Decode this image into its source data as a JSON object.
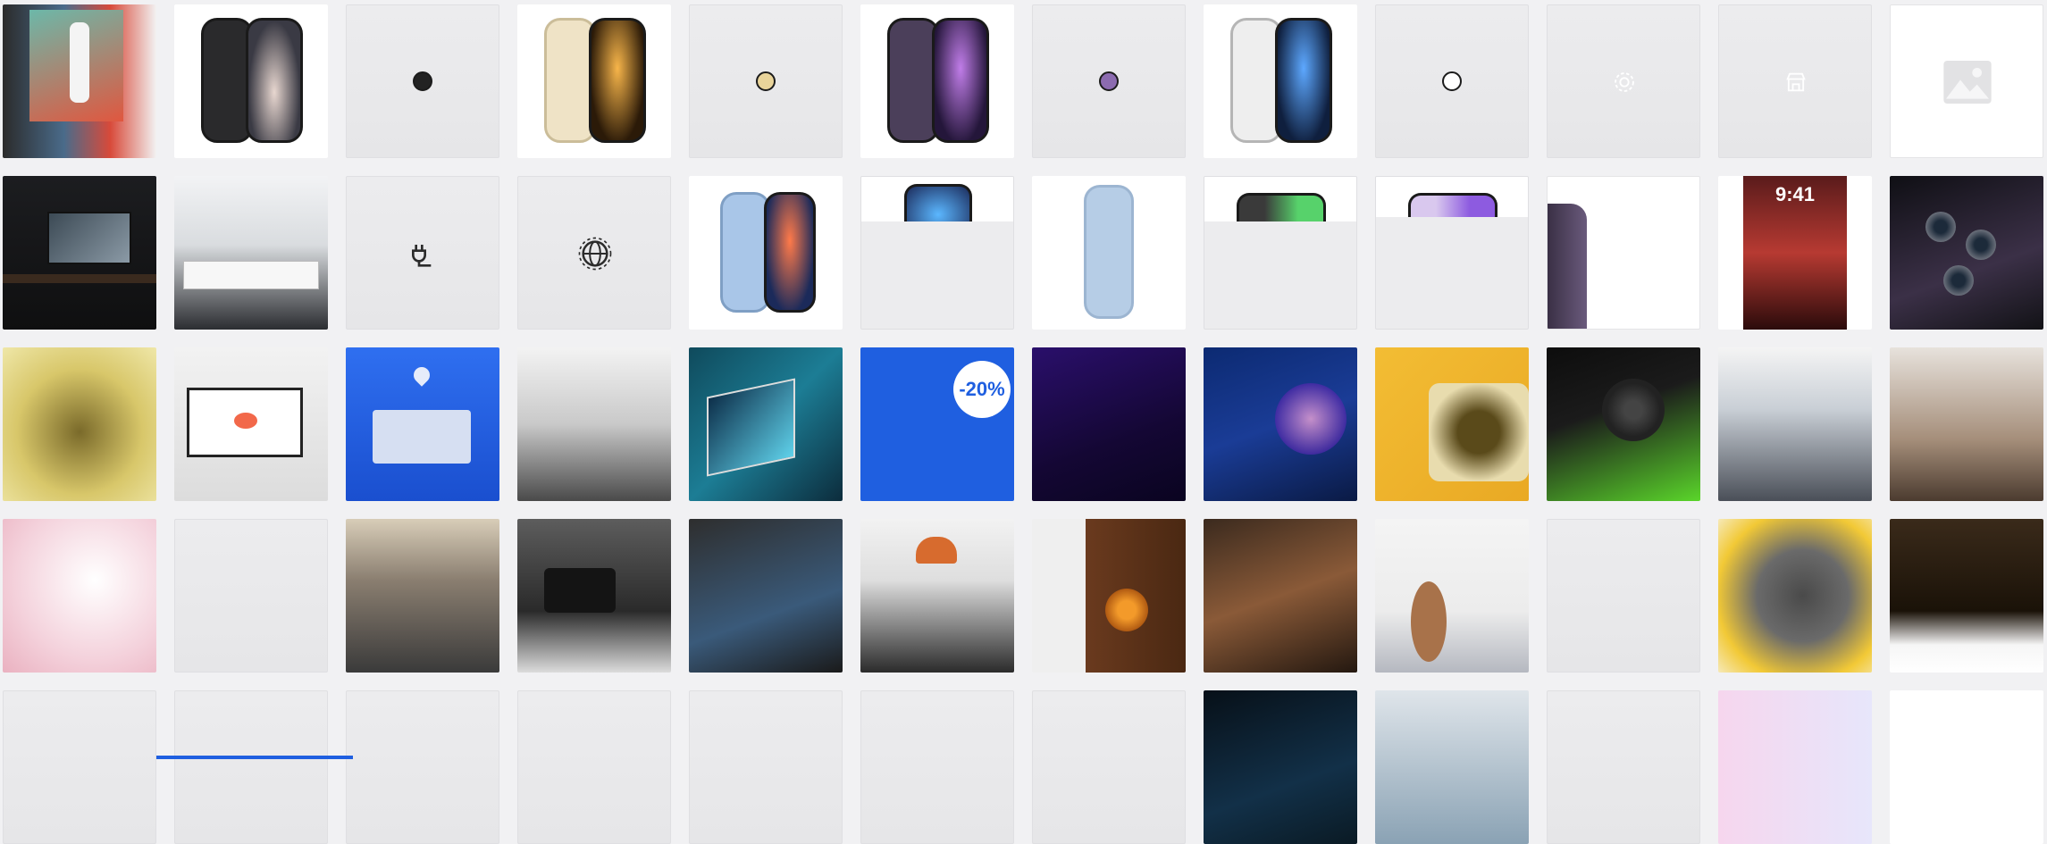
{
  "colors": {
    "page_background": "#f1f1f3",
    "placeholder": "#ececee",
    "accent_blue": "#1f5fe0"
  },
  "swatches": [
    {
      "name": "space-black",
      "color": "#222222"
    },
    {
      "name": "gold",
      "color": "#e9d49a"
    },
    {
      "name": "deep-purple",
      "color": "#8c6bb0"
    },
    {
      "name": "silver",
      "color": "#ffffff"
    }
  ],
  "icons": [
    "settings-icon",
    "store-icon",
    "image-placeholder-icon",
    "plug-icon",
    "globe-icon"
  ],
  "promo": {
    "discount": "-20%"
  },
  "lockscreen": {
    "time": "9:41"
  }
}
